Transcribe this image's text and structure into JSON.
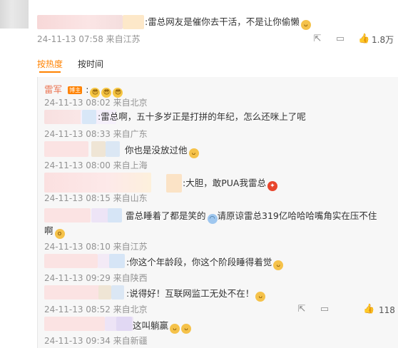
{
  "top_comment": {
    "text": ":雷总网友是催你去干活，不是让你偷懒",
    "meta": "24-11-13 07:58 来自江苏",
    "like_count": "1.8万"
  },
  "sort_tabs": {
    "hot": "按热度",
    "time": "按时间"
  },
  "post": {
    "author": "雷军",
    "badge": "博主",
    "prefix": ":",
    "meta": "24-11-13 08:02 来自北京"
  },
  "replies": [
    {
      "text": ":雷总啊，五十多岁正是打拼的年纪，怎么还咪上了呢",
      "meta": "24-11-13 08:33 来自广东"
    },
    {
      "text": "你也是没放过他",
      "meta": "24-11-13 08:00 来自上海"
    },
    {
      "text": ":大胆，敢PUA我雷总",
      "meta": "24-11-13 08:15 来自山东"
    },
    {
      "text": "雷总睡着了都是笑的",
      "text2": "请原谅雷总319亿哈哈哈嘴角实在压不住",
      "text3": "啊",
      "meta": "24-11-13 08:10 来自江苏"
    },
    {
      "text": ":你这个年龄段，你这个阶段睡得着觉",
      "meta": "24-11-13 09:29 来自陕西"
    },
    {
      "text": ":说得好！互联网监工无处不在！",
      "meta": "24-11-13 08:52 来自北京",
      "like_count": "118"
    },
    {
      "text": "这叫躺赢",
      "meta": "24-11-13 09:34 来自新疆"
    }
  ],
  "icons": [
    "share-icon",
    "comment-icon",
    "like-icon"
  ]
}
